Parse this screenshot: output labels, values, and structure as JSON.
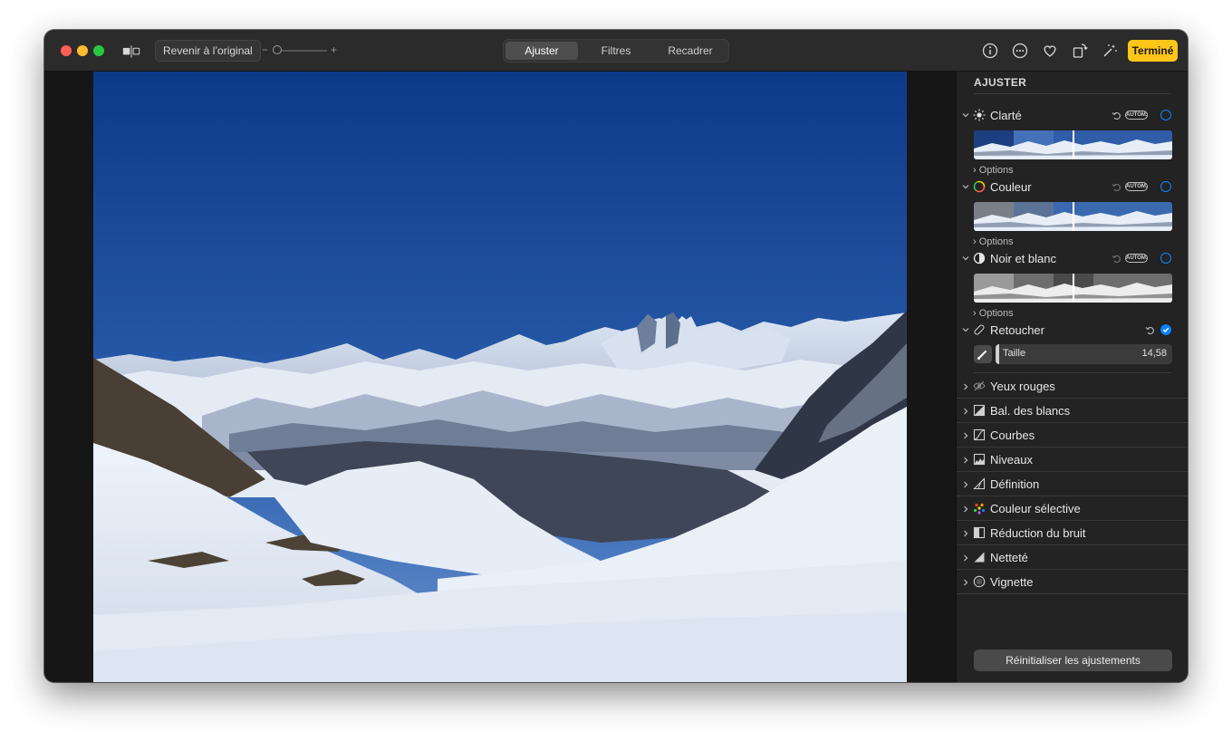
{
  "toolbar": {
    "revert_label": "Revenir à l’original",
    "zoom_minus": "−",
    "zoom_plus": "+",
    "tabs": [
      {
        "label": "Ajuster",
        "active": true
      },
      {
        "label": "Filtres",
        "active": false
      },
      {
        "label": "Recadrer",
        "active": false
      }
    ],
    "done_label": "Terminé",
    "icons": [
      "info-icon",
      "more-icon",
      "heart-icon",
      "rotate-icon",
      "magic-wand-icon"
    ]
  },
  "sidebar": {
    "title": "AJUSTER",
    "auto_label": "AUTOM.",
    "options_label": "Options",
    "sections": [
      {
        "label": "Clarté",
        "icon": "sun-icon"
      },
      {
        "label": "Couleur",
        "icon": "color-circle-icon"
      },
      {
        "label": "Noir et blanc",
        "icon": "half-circle-icon"
      }
    ],
    "retouch": {
      "label": "Retoucher",
      "size_label": "Taille",
      "size_value": "14,58",
      "checked": true
    },
    "tools": [
      {
        "label": "Yeux rouges",
        "icon": "eye-icon"
      },
      {
        "label": "Bal. des blancs",
        "icon": "white-balance-icon"
      },
      {
        "label": "Courbes",
        "icon": "curves-icon"
      },
      {
        "label": "Niveaux",
        "icon": "levels-icon"
      },
      {
        "label": "Définition",
        "icon": "definition-icon"
      },
      {
        "label": "Couleur sélective",
        "icon": "selective-color-icon"
      },
      {
        "label": "Réduction du bruit",
        "icon": "noise-reduction-icon"
      },
      {
        "label": "Netteté",
        "icon": "sharpen-icon"
      },
      {
        "label": "Vignette",
        "icon": "vignette-icon"
      }
    ],
    "reset_label": "Réinitialiser les ajustements"
  },
  "colors": {
    "accent": "#ffc61a",
    "check_blue": "#0a84ff",
    "traffic_red": "#ff5f57",
    "traffic_yellow": "#febc2e",
    "traffic_green": "#28c840"
  }
}
